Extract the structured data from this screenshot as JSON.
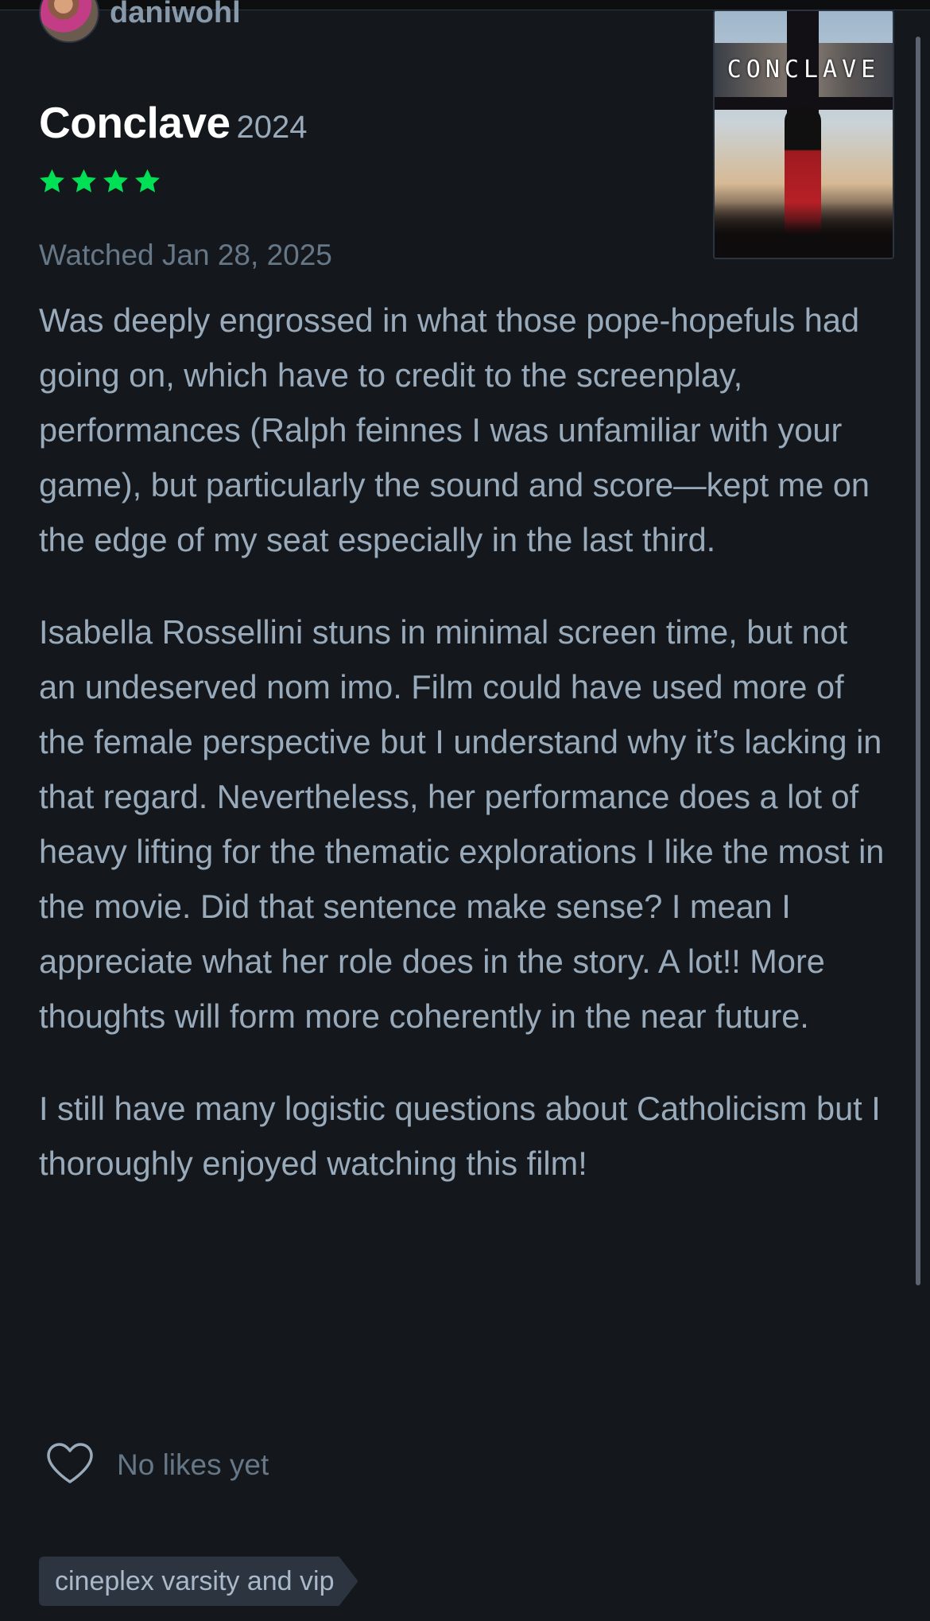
{
  "review": {
    "username": "daniwohl",
    "film_title": "Conclave",
    "film_year": "2024",
    "rating_stars": 4,
    "star_color": "#00e054",
    "watched_text": "Watched Jan 28, 2025",
    "poster_title": "CONCLAVE",
    "paragraphs": [
      "Was deeply engrossed in what those pope-hopefuls had going on, which have to credit to the screenplay, performances (Ralph feinnes I was unfamiliar with your game), but particularly the sound and score—kept me on the edge of my seat especially in the last third.",
      "Isabella Rossellini stuns in minimal screen time, but not an undeserved nom imo. Film could have used more of the female perspective but I understand why it’s lacking in that regard. Nevertheless, her performance does a lot of heavy lifting for the thematic explorations I like the most in the movie. Did that sentence make sense? I mean I appreciate what her role does in the story. A lot!! More thoughts will form more coherently in the near future.",
      "I still have many logistic questions about Catholicism but I thoroughly enjoyed watching this film!"
    ],
    "likes_text": "No likes yet",
    "tag": "cineplex varsity and vip"
  },
  "icons": {
    "like": "heart-outline-icon",
    "rating": "star-icon"
  },
  "colors": {
    "background": "#14181c",
    "body_text": "#99aabb",
    "muted_text": "#667788",
    "tag_background": "#2c3440"
  }
}
